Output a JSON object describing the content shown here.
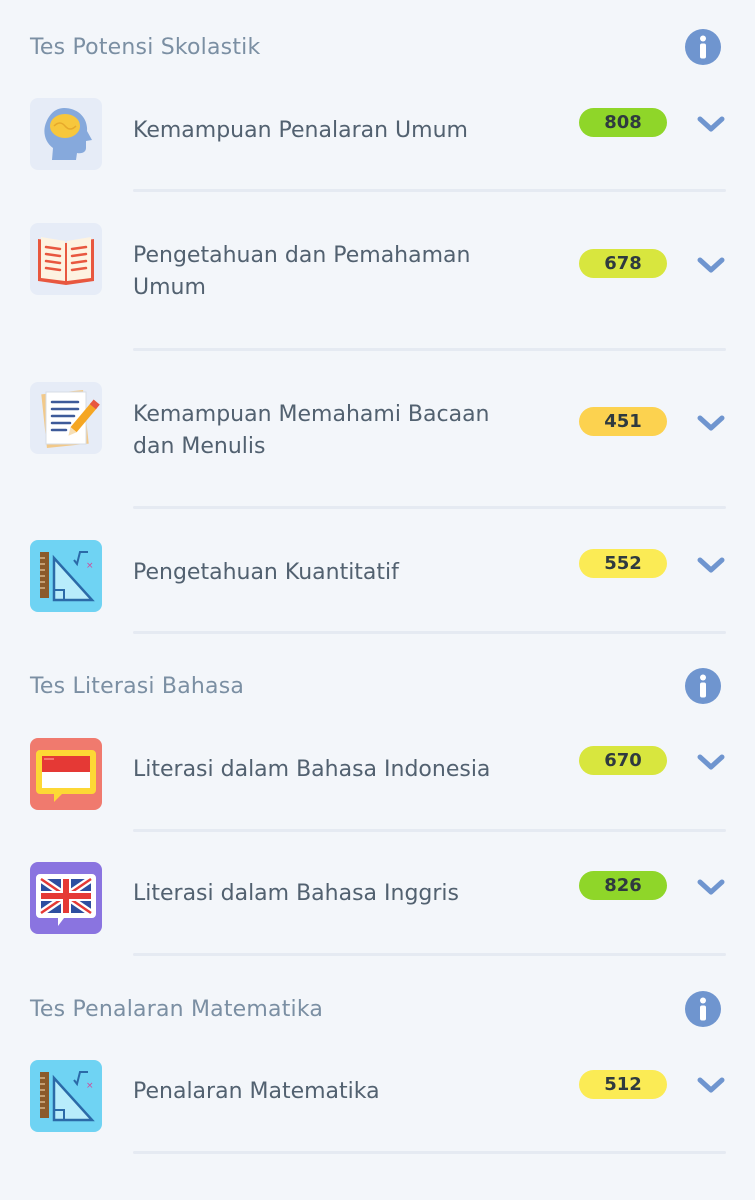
{
  "colors": {
    "background": "#f3f6fa",
    "info": "#6f95cf",
    "chevron": "#6f95cf",
    "badge_green": "#8fd629",
    "badge_lime": "#d8e63e",
    "badge_orange": "#fcd24f",
    "badge_yellow": "#fbeb55"
  },
  "sections": [
    {
      "title": "Tes Potensi Skolastik",
      "info_icon": "info-icon",
      "items": [
        {
          "label": "Kemampuan Penalaran Umum",
          "score": "808",
          "badge_color": "#8fd629",
          "icon": "head-brain-icon"
        },
        {
          "label": "Pengetahuan dan Pemahaman Umum",
          "score": "678",
          "badge_color": "#d8e63e",
          "icon": "open-book-icon"
        },
        {
          "label": "Kemampuan Memahami Bacaan dan Menulis",
          "score": "451",
          "badge_color": "#fcd24f",
          "icon": "paper-pencil-icon"
        },
        {
          "label": "Pengetahuan Kuantitatif",
          "score": "552",
          "badge_color": "#fbeb55",
          "icon": "ruler-triangle-icon"
        }
      ]
    },
    {
      "title": "Tes Literasi Bahasa",
      "info_icon": "info-icon",
      "items": [
        {
          "label": "Literasi dalam Bahasa Indonesia",
          "score": "670",
          "badge_color": "#d8e63e",
          "icon": "indonesia-flag-speech-icon"
        },
        {
          "label": "Literasi dalam Bahasa Inggris",
          "score": "826",
          "badge_color": "#8fd629",
          "icon": "uk-flag-speech-icon"
        }
      ]
    },
    {
      "title": "Tes Penalaran Matematika",
      "info_icon": "info-icon",
      "items": [
        {
          "label": "Penalaran Matematika",
          "score": "512",
          "badge_color": "#fbeb55",
          "icon": "ruler-triangle-icon"
        }
      ]
    }
  ]
}
